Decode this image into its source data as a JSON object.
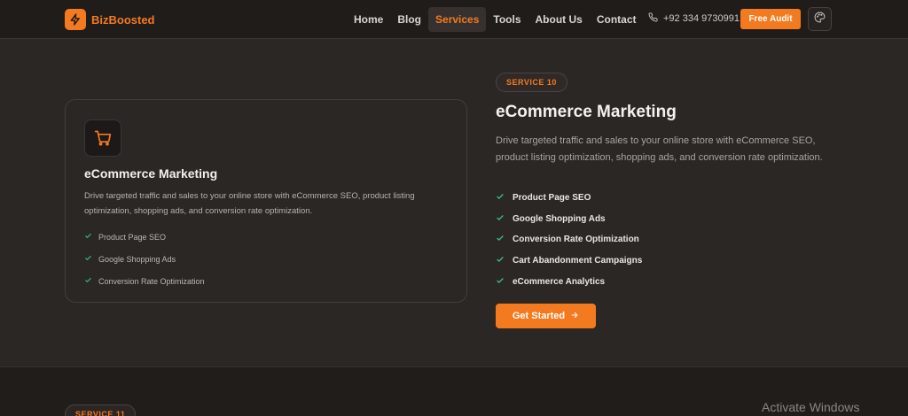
{
  "brand": {
    "name": "BizBoosted",
    "accent": "#f47a1f"
  },
  "nav": {
    "links": [
      {
        "label": "Home"
      },
      {
        "label": "Blog"
      },
      {
        "label": "Services"
      },
      {
        "label": "Tools"
      },
      {
        "label": "About Us"
      },
      {
        "label": "Contact"
      }
    ],
    "active": "Services",
    "phone": "+92 334 9730991",
    "cta_label": "Free Audit",
    "icons": {
      "phone": "phone-icon",
      "theme": "palette-icon",
      "logo": "lightning-icon"
    }
  },
  "card": {
    "icon": "shopping-cart-icon",
    "title": "eCommerce Marketing",
    "description": "Drive targeted traffic and sales to your online store with eCommerce SEO, product listing optimization, shopping ads, and conversion rate optimization.",
    "features": [
      "Product Page SEO",
      "Google Shopping Ads",
      "Conversion Rate Optimization"
    ]
  },
  "detail": {
    "badge": "SERVICE 10",
    "title": "eCommerce Marketing",
    "description": "Drive targeted traffic and sales to your online store with eCommerce SEO, product listing optimization, shopping ads, and conversion rate optimization.",
    "features": [
      "Product Page SEO",
      "Google Shopping Ads",
      "Conversion Rate Optimization",
      "Cart Abandonment Campaigns",
      "eCommerce Analytics"
    ],
    "button_label": "Get Started",
    "check_color": "#3fbf7f"
  },
  "next": {
    "badge": "SERVICE 11"
  },
  "watermark": "Activate Windows"
}
